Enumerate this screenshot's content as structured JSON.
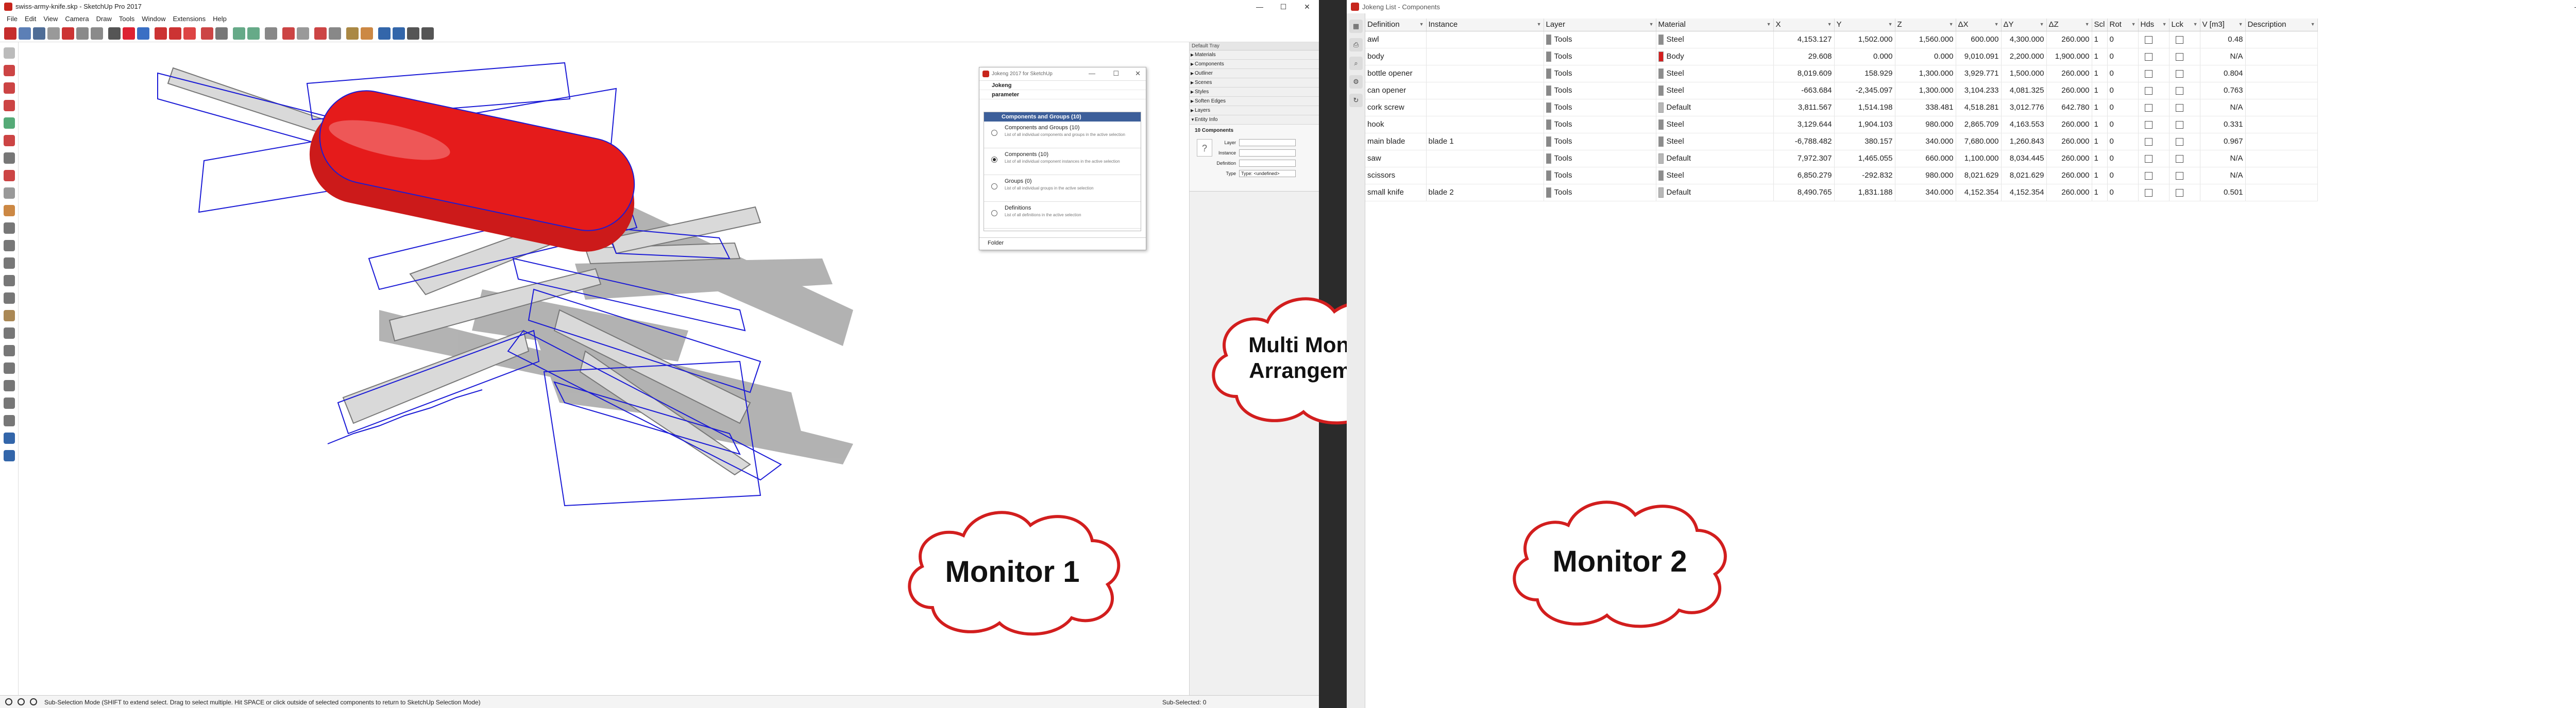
{
  "monitor1": {
    "window_title": "swiss-army-knife.skp - SketchUp Pro 2017",
    "window_controls": [
      "—",
      "☐",
      "✕"
    ],
    "menu": [
      "File",
      "Edit",
      "View",
      "Camera",
      "Draw",
      "Tools",
      "Window",
      "Extensions",
      "Help"
    ],
    "status_text": "Sub-Selection Mode (SHIFT to extend select. Drag to select multiple. Hit SPACE or click outside of selected components to return to SketchUp Selection Mode)",
    "status_right": "Sub-Selected: 0",
    "cloud_label": "Monitor 1"
  },
  "jokeng_dialog": {
    "title": "Jokeng 2017 for SketchUp",
    "row_jokeng": "Jokeng",
    "row_parameter": "parameter",
    "list_header": "Components and Groups (10)",
    "options": [
      {
        "title": "Components and Groups (10)",
        "desc": "List of all individual components and groups in the active selection",
        "selected": false
      },
      {
        "title": "Components (10)",
        "desc": "List of all individual component instances in the active selection",
        "selected": true
      },
      {
        "title": "Groups (0)",
        "desc": "List of all individual groups in the active selection",
        "selected": false
      },
      {
        "title": "Definitions",
        "desc": "List of all definitions in the active selection",
        "selected": false
      }
    ],
    "folder_label": "Folder"
  },
  "tray": {
    "title": "Default Tray",
    "items": [
      "Materials",
      "Components",
      "Outliner",
      "Scenes",
      "Styles",
      "Soften Edges",
      "Layers",
      "Entity Info"
    ],
    "entity_header": "10 Components",
    "labels": {
      "layer": "Layer",
      "instance": "Instance",
      "definition": "Definition",
      "type": "Type"
    },
    "type_value": "Type: <undefined>"
  },
  "center_cloud": "Multi Monitor Arrangement",
  "monitor2": {
    "window_title": "Jokeng List - Components",
    "cloud_label": "Monitor 2",
    "columns": [
      "Definition",
      "Instance",
      "Layer",
      "Material",
      "X",
      "Y",
      "Z",
      "ΔX",
      "ΔY",
      "ΔZ",
      "Scl",
      "Rot",
      "Hds",
      "Lck",
      "V [m3]",
      "Description"
    ],
    "rows": [
      {
        "definition": "awl",
        "instance": "",
        "layer": "Tools",
        "material": "Steel",
        "matcolor": "#8c8c8c",
        "x": "4,153.127",
        "y": "1,502.000",
        "z": "1,560.000",
        "dx": "600.000",
        "dy": "4,300.000",
        "dz": "260.000",
        "scl": "1",
        "rot": "0",
        "v": "0.48"
      },
      {
        "definition": "body",
        "instance": "",
        "layer": "Tools",
        "material": "Body",
        "matcolor": "#d51e1e",
        "x": "29.608",
        "y": "0.000",
        "z": "0.000",
        "dx": "9,010.091",
        "dy": "2,200.000",
        "dz": "1,900.000",
        "scl": "1",
        "rot": "0",
        "v": "N/A"
      },
      {
        "definition": "bottle opener",
        "instance": "",
        "layer": "Tools",
        "material": "Steel",
        "matcolor": "#8c8c8c",
        "x": "8,019.609",
        "y": "158.929",
        "z": "1,300.000",
        "dx": "3,929.771",
        "dy": "1,500.000",
        "dz": "260.000",
        "scl": "1",
        "rot": "0",
        "v": "0.804"
      },
      {
        "definition": "can opener",
        "instance": "",
        "layer": "Tools",
        "material": "Steel",
        "matcolor": "#8c8c8c",
        "x": "-663.684",
        "y": "-2,345.097",
        "z": "1,300.000",
        "dx": "3,104.233",
        "dy": "4,081.325",
        "dz": "260.000",
        "scl": "1",
        "rot": "0",
        "v": "0.763"
      },
      {
        "definition": "cork screw",
        "instance": "",
        "layer": "Tools",
        "material": "Default",
        "matcolor": "#b8b8b8",
        "x": "3,811.567",
        "y": "1,514.198",
        "z": "338.481",
        "dx": "4,518.281",
        "dy": "3,012.776",
        "dz": "642.780",
        "scl": "1",
        "rot": "0",
        "v": "N/A"
      },
      {
        "definition": "hook",
        "instance": "",
        "layer": "Tools",
        "material": "Steel",
        "matcolor": "#8c8c8c",
        "x": "3,129.644",
        "y": "1,904.103",
        "z": "980.000",
        "dx": "2,865.709",
        "dy": "4,163.553",
        "dz": "260.000",
        "scl": "1",
        "rot": "0",
        "v": "0.331"
      },
      {
        "definition": "main blade",
        "instance": "blade 1",
        "layer": "Tools",
        "material": "Steel",
        "matcolor": "#8c8c8c",
        "x": "-6,788.482",
        "y": "380.157",
        "z": "340.000",
        "dx": "7,680.000",
        "dy": "1,260.843",
        "dz": "260.000",
        "scl": "1",
        "rot": "0",
        "v": "0.967"
      },
      {
        "definition": "saw",
        "instance": "",
        "layer": "Tools",
        "material": "Default",
        "matcolor": "#b8b8b8",
        "x": "7,972.307",
        "y": "1,465.055",
        "z": "660.000",
        "dx": "1,100.000",
        "dy": "8,034.445",
        "dz": "260.000",
        "scl": "1",
        "rot": "0",
        "v": "N/A"
      },
      {
        "definition": "scissors",
        "instance": "",
        "layer": "Tools",
        "material": "Steel",
        "matcolor": "#8c8c8c",
        "x": "6,850.279",
        "y": "-292.832",
        "z": "980.000",
        "dx": "8,021.629",
        "dy": "8,021.629",
        "dz": "260.000",
        "scl": "1",
        "rot": "0",
        "v": "N/A"
      },
      {
        "definition": "small knife",
        "instance": "blade 2",
        "layer": "Tools",
        "material": "Default",
        "matcolor": "#b8b8b8",
        "x": "8,490.765",
        "y": "1,831.188",
        "z": "340.000",
        "dx": "4,152.354",
        "dy": "4,152.354",
        "dz": "260.000",
        "scl": "1",
        "rot": "0",
        "v": "0.501"
      }
    ]
  }
}
